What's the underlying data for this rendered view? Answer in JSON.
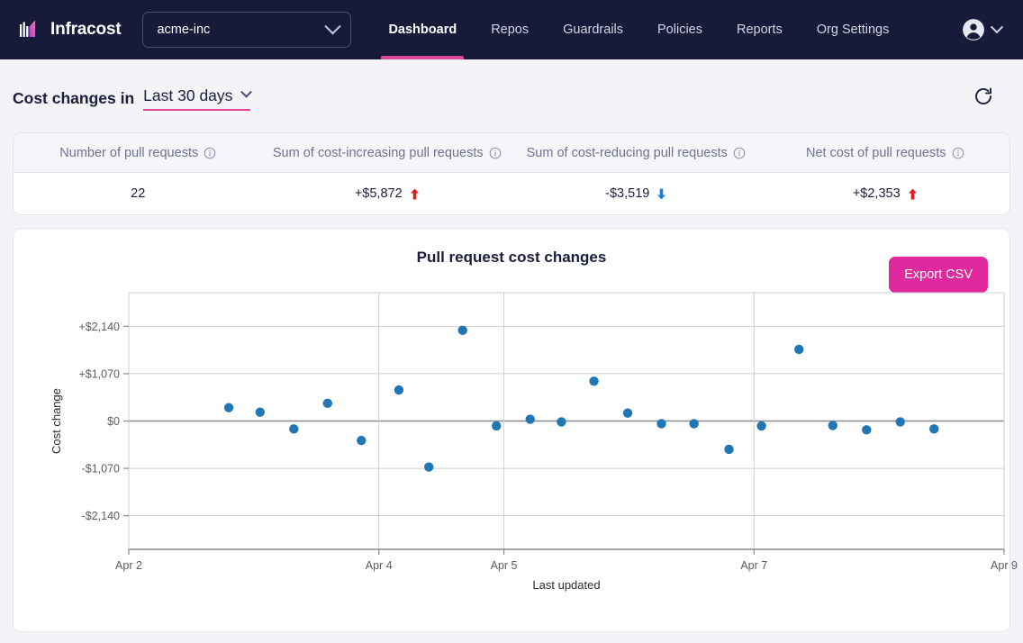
{
  "brand": {
    "name": "Infracost",
    "logo_icon": "infracost-logo-icon"
  },
  "org_switcher": {
    "value": "acme-inc",
    "chevron_icon": "chevron-down-icon"
  },
  "nav": {
    "items": [
      {
        "label": "Dashboard",
        "active": true
      },
      {
        "label": "Repos",
        "active": false
      },
      {
        "label": "Guardrails",
        "active": false
      },
      {
        "label": "Policies",
        "active": false
      },
      {
        "label": "Reports",
        "active": false
      },
      {
        "label": "Org Settings",
        "active": false
      }
    ],
    "account": {
      "avatar_icon": "user-circle-icon",
      "chevron_icon": "chevron-down-icon"
    }
  },
  "page": {
    "title_prefix": "Cost changes in",
    "range_value": "Last 30 days",
    "range_chevron_icon": "chevron-down-icon",
    "refresh_icon": "refresh-icon"
  },
  "stats": {
    "columns": [
      {
        "header": "Number of pull requests",
        "info_icon": "info-icon",
        "value": "22",
        "trend": "none"
      },
      {
        "header": "Sum of cost-increasing pull requests",
        "info_icon": "info-icon",
        "value": "+$5,872",
        "trend": "up"
      },
      {
        "header": "Sum of cost-reducing pull requests",
        "info_icon": "info-icon",
        "value": "-$3,519",
        "trend": "down"
      },
      {
        "header": "Net cost of pull requests",
        "info_icon": "info-icon",
        "value": "+$2,353",
        "trend": "up"
      }
    ],
    "trend_up_color": "#e02020",
    "trend_down_color": "#1c7fe0"
  },
  "chart_card": {
    "title": "Pull request cost changes",
    "export_label": "Export CSV",
    "export_color": "#e0299e"
  },
  "chart_data": {
    "type": "scatter",
    "title": "Pull request cost changes",
    "xlabel": "Last updated",
    "ylabel": "Cost change",
    "grid": true,
    "legend": false,
    "marker_color": "#2077b4",
    "x_tick_labels": [
      "Apr 2",
      "Apr 4",
      "Apr 5",
      "Apr 7",
      "Apr 9"
    ],
    "x_tick_positions": [
      0,
      2,
      3,
      5,
      7
    ],
    "xlim": [
      0,
      7
    ],
    "y_tick_labels": [
      "+$2,140",
      "+$1,070",
      "$0",
      "-$1,070",
      "-$2,140"
    ],
    "y_tick_values": [
      2140,
      1070,
      0,
      -1070,
      -2140
    ],
    "ylim": [
      -2900,
      2900
    ],
    "points": [
      {
        "x": 0.8,
        "y": 300
      },
      {
        "x": 1.05,
        "y": 200
      },
      {
        "x": 1.32,
        "y": -180
      },
      {
        "x": 1.59,
        "y": 400
      },
      {
        "x": 1.86,
        "y": -440
      },
      {
        "x": 2.16,
        "y": 700
      },
      {
        "x": 2.4,
        "y": -1040
      },
      {
        "x": 2.67,
        "y": 2050
      },
      {
        "x": 2.94,
        "y": -110
      },
      {
        "x": 3.21,
        "y": 40
      },
      {
        "x": 3.46,
        "y": -20
      },
      {
        "x": 3.72,
        "y": 900
      },
      {
        "x": 3.99,
        "y": 180
      },
      {
        "x": 4.26,
        "y": -60
      },
      {
        "x": 4.52,
        "y": -60
      },
      {
        "x": 4.8,
        "y": -640
      },
      {
        "x": 5.06,
        "y": -110
      },
      {
        "x": 5.36,
        "y": 1620
      },
      {
        "x": 5.63,
        "y": -100
      },
      {
        "x": 5.9,
        "y": -200
      },
      {
        "x": 6.17,
        "y": -20
      },
      {
        "x": 6.44,
        "y": -180
      }
    ]
  }
}
